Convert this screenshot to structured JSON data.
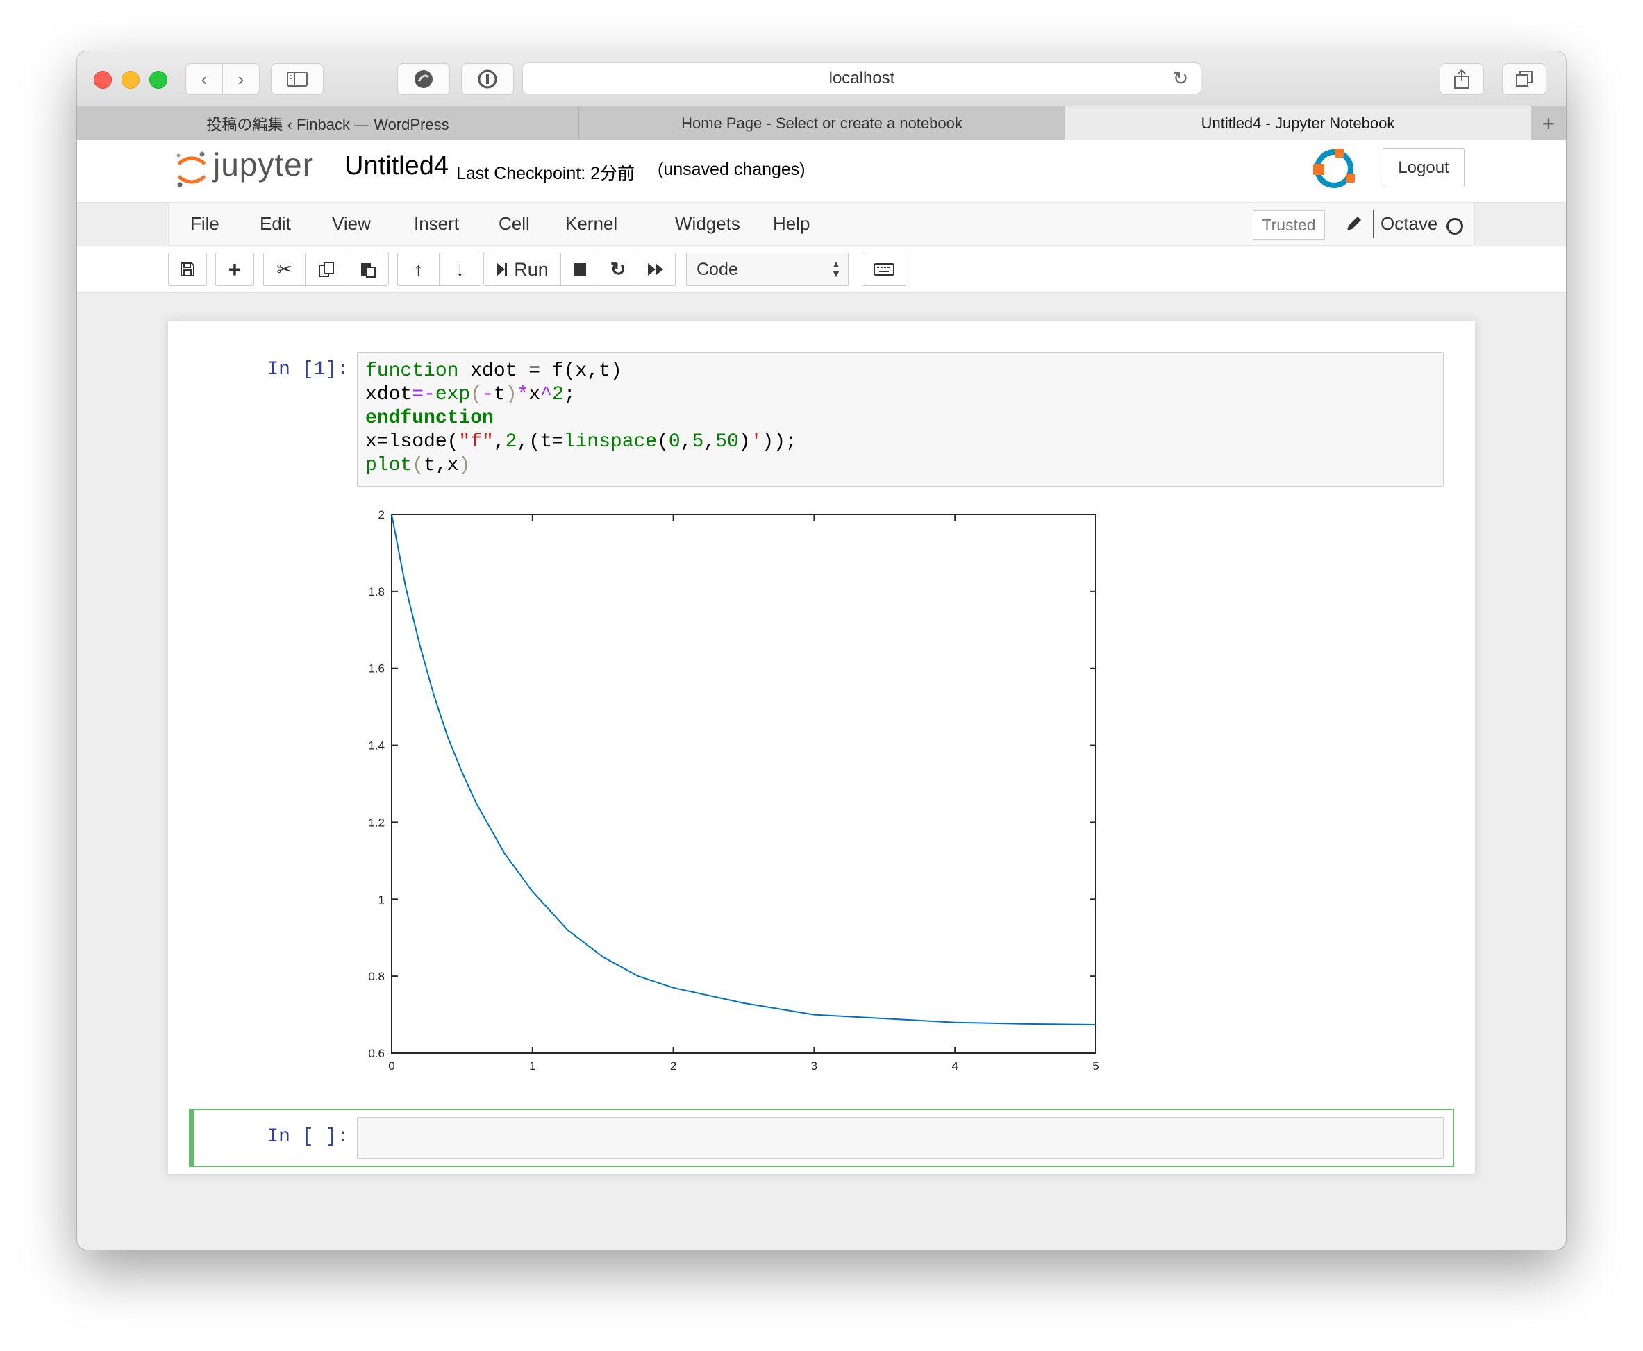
{
  "browser": {
    "url": "localhost",
    "tabs": [
      {
        "label": "投稿の編集 ‹ Finback — WordPress",
        "active": false
      },
      {
        "label": "Home Page - Select or create a notebook",
        "active": false
      },
      {
        "label": "Untitled4 - Jupyter Notebook",
        "active": true
      }
    ]
  },
  "header": {
    "logo_text": "jupyter",
    "notebook_title": "Untitled4",
    "checkpoint": "Last Checkpoint: 2分前",
    "unsaved": "(unsaved changes)",
    "logout_label": "Logout"
  },
  "menubar": {
    "items": [
      "File",
      "Edit",
      "View",
      "Insert",
      "Cell",
      "Kernel",
      "Widgets",
      "Help"
    ],
    "trusted_label": "Trusted",
    "kernel_name": "Octave"
  },
  "toolbar": {
    "run_label": "Run",
    "cell_type": "Code",
    "icons": [
      "save-icon",
      "plus-icon",
      "scissors-icon",
      "copy-icon",
      "paste-icon",
      "arrow-up-icon",
      "arrow-down-icon",
      "step-forward-icon",
      "stop-icon",
      "restart-icon",
      "fast-forward-icon",
      "keyboard-icon"
    ]
  },
  "cells": [
    {
      "prompt": "In [1]:",
      "code": [
        "function xdot = f(x,t)",
        "xdot=-exp(-t)*x^2;",
        "endfunction",
        "x=lsode(\"f\",2,(t=linspace(0,5,50)'));",
        "plot(t,x)"
      ]
    },
    {
      "prompt": "In [ ]:",
      "code": []
    }
  ],
  "chart_data": {
    "type": "line",
    "title": "",
    "xlabel": "",
    "ylabel": "",
    "xlim": [
      0,
      5
    ],
    "ylim": [
      0.6,
      2
    ],
    "xticks": [
      "0",
      "1",
      "2",
      "3",
      "4",
      "5"
    ],
    "yticks": [
      "0.6",
      "0.8",
      "1",
      "1.2",
      "1.4",
      "1.6",
      "1.8",
      "2"
    ],
    "grid": false,
    "color": "#0072bd",
    "x": [
      0,
      0.1,
      0.2,
      0.3,
      0.4,
      0.5,
      0.6,
      0.8,
      1.0,
      1.25,
      1.5,
      1.75,
      2.0,
      2.5,
      3.0,
      3.5,
      4.0,
      4.5,
      5.0
    ],
    "y": [
      2.0,
      1.81,
      1.66,
      1.53,
      1.42,
      1.33,
      1.25,
      1.12,
      1.02,
      0.92,
      0.85,
      0.8,
      0.77,
      0.73,
      0.7,
      0.69,
      0.68,
      0.676,
      0.674
    ]
  },
  "colors": {
    "prompt": "#303f9f",
    "selected_border": "#66bb6a",
    "code_keyword": "#008000",
    "code_operator": "#aa22ff",
    "code_string": "#ba2121"
  }
}
